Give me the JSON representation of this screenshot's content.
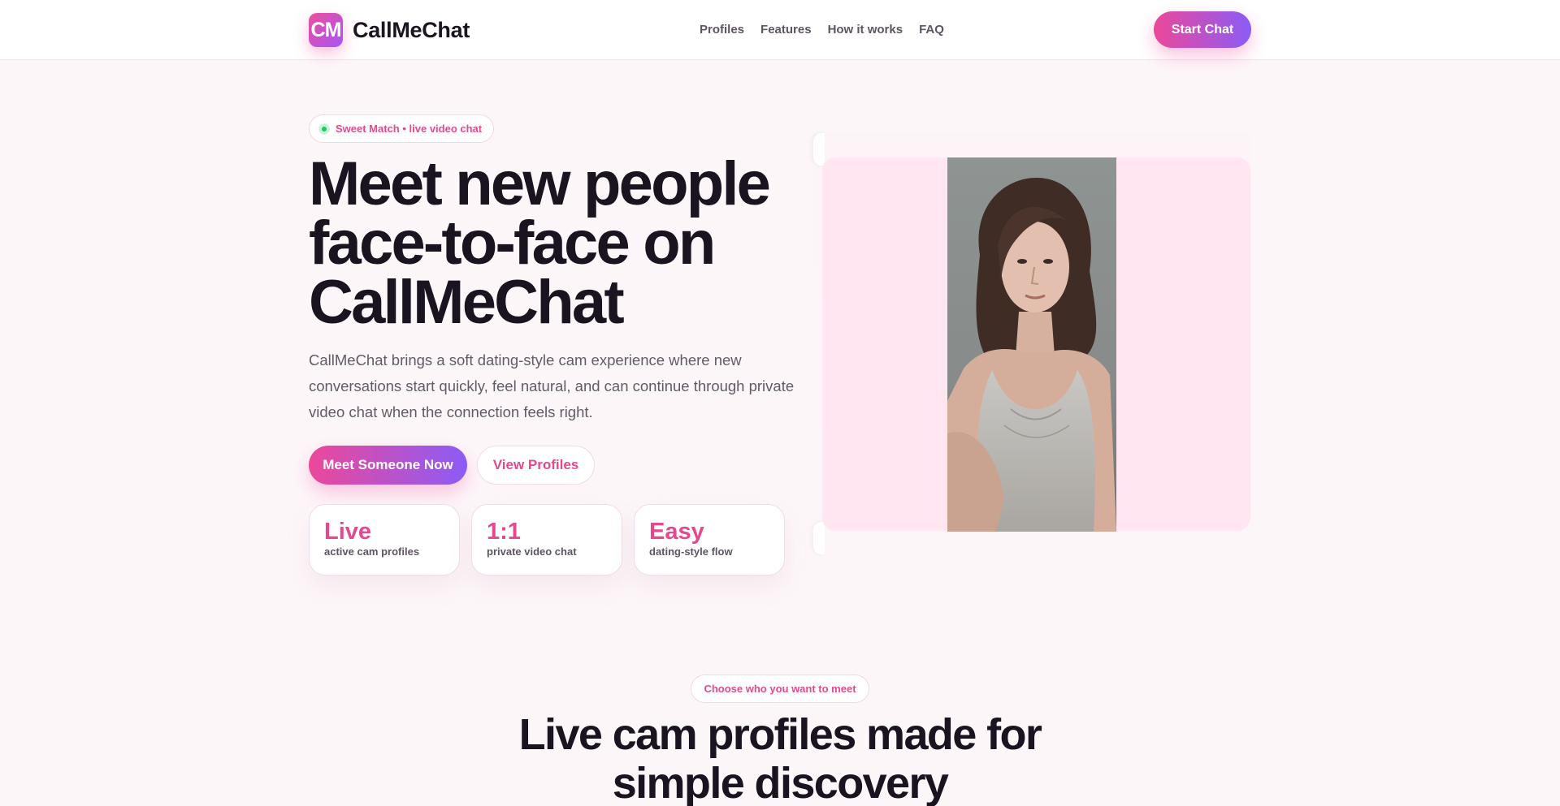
{
  "header": {
    "logo_text": "CM",
    "brand_name": "CallMeChat",
    "nav": [
      "Profiles",
      "Features",
      "How it works",
      "FAQ"
    ],
    "cta_label": "Start Chat"
  },
  "hero": {
    "tag_label": "Sweet Match • live video chat",
    "title": "Meet new people face-to-face on CallMeChat",
    "description": "CallMeChat brings a soft dating-style cam experience where new conversations start quickly, feel natural, and can continue through private video chat when the connection feels right.",
    "primary_button": "Meet Someone Now",
    "secondary_button": "View Profiles",
    "stats": [
      {
        "value": "Live",
        "label": "active cam profiles"
      },
      {
        "value": "1:1",
        "label": "private video chat"
      },
      {
        "value": "Easy",
        "label": "dating-style flow"
      }
    ]
  },
  "section2": {
    "tag_label": "Choose who you want to meet",
    "title": "Live cam profiles made for simple discovery"
  },
  "colors": {
    "accent_pink": "#ec4899",
    "accent_violet": "#8b5cf6",
    "text_pink": "#e5488e",
    "heading": "#1a1320",
    "background": "#fdf6f9"
  }
}
